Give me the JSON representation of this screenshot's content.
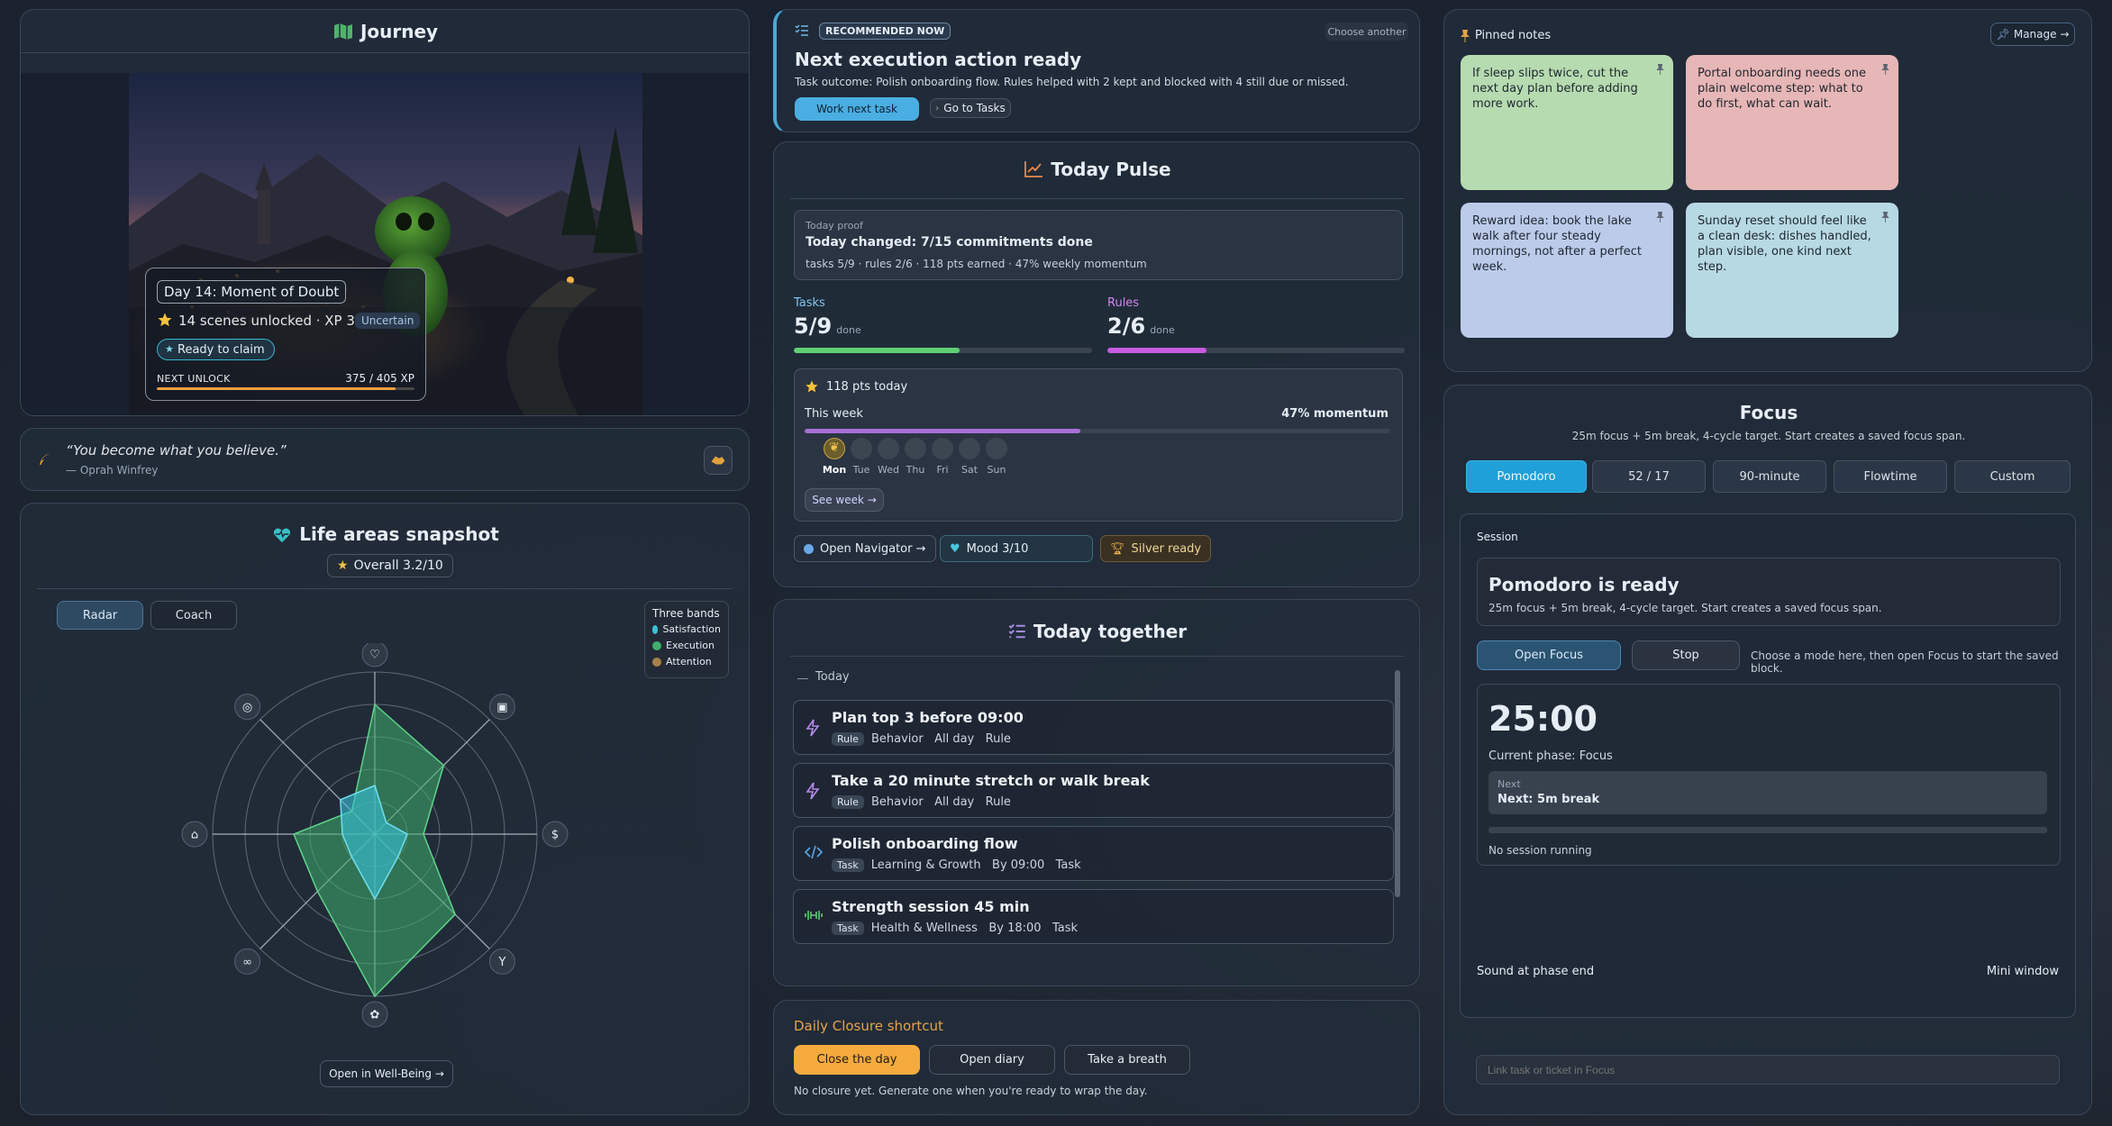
{
  "journey": {
    "title": "Journey",
    "day_title": "Day 14: Moment of Doubt",
    "scenes": "14 scenes unlocked · XP 375",
    "status_badge": "Uncertain",
    "claim_label": "Ready to claim",
    "next_unlock_label": "NEXT UNLOCK",
    "xp_progress": "375 / 405 XP",
    "xp_fraction": 0.926
  },
  "quote": {
    "text": "“You become what you believe.”",
    "author": "— Oprah Winfrey"
  },
  "life_areas": {
    "title": "Life areas snapshot",
    "overall": "Overall 3.2/10",
    "tabs": [
      "Radar",
      "Coach"
    ],
    "legend_title": "Three bands",
    "legend": [
      {
        "label": "Satisfaction",
        "color": "#39c2d7"
      },
      {
        "label": "Execution",
        "color": "#3fae6e"
      },
      {
        "label": "Attention",
        "color": "#a8824a"
      }
    ],
    "open_link": "Open in Well-Being →",
    "axis_icons": [
      "heart-icon",
      "briefcase-icon",
      "dollar-icon",
      "trophy-icon",
      "leaf-icon",
      "brain-icon",
      "home-icon",
      "compass-icon"
    ],
    "chart_data": {
      "type": "radar",
      "axes": 8,
      "series": [
        {
          "values": [
            8,
            6,
            3,
            7,
            10,
            5,
            5,
            2
          ]
        },
        {
          "values": [
            3,
            1,
            2,
            2,
            4,
            2,
            2,
            3
          ]
        }
      ],
      "rmax": 10,
      "rings": 5
    }
  },
  "recommended": {
    "badge": "RECOMMENDED NOW",
    "choose": "Choose another",
    "title": "Next execution action ready",
    "subtitle": "Task outcome: Polish onboarding flow. Rules helped with 2 kept and blocked with 4 still due or missed.",
    "primary": "Work next task",
    "secondary": "Go to Tasks"
  },
  "pulse": {
    "title": "Today Pulse",
    "proof_label": "Today proof",
    "proof_title": "Today changed: 7/15 commitments done",
    "proof_sub": "tasks 5/9 · rules 2/6 · 118 pts earned · 47% weekly momentum",
    "tasks_label": "Tasks",
    "tasks_value": "5/9",
    "tasks_done": "done",
    "tasks_fraction": 0.556,
    "rules_label": "Rules",
    "rules_value": "2/6",
    "rules_done": "done",
    "rules_fraction": 0.333,
    "pts": "118 pts today",
    "week_label": "This week",
    "momentum": "47% momentum",
    "momentum_fraction": 0.47,
    "days": [
      "Mon",
      "Tue",
      "Wed",
      "Thu",
      "Fri",
      "Sat",
      "Sun"
    ],
    "see_week": "See week →",
    "navigator": "Open Navigator →",
    "mood": "Mood 3/10",
    "silver": "Silver ready"
  },
  "together": {
    "title": "Today together",
    "section": "Today",
    "items": [
      {
        "title": "Plan top 3 before 09:00",
        "tag": "Rule",
        "meta": "Behavior   All day   Rule",
        "icon": "bolt-icon"
      },
      {
        "title": "Take a 20 minute stretch or walk break",
        "tag": "Rule",
        "meta": "Behavior   All day   Rule",
        "icon": "bolt-icon"
      },
      {
        "title": "Polish onboarding flow",
        "tag": "Task",
        "meta": "Learning & Growth   By 09:00   Task",
        "icon": "code-icon"
      },
      {
        "title": "Strength session 45 min",
        "tag": "Task",
        "meta": "Health & Wellness   By 18:00   Task",
        "icon": "dumbbell-icon"
      }
    ]
  },
  "closure": {
    "title": "Daily Closure shortcut",
    "close": "Close the day",
    "diary": "Open diary",
    "breath": "Take a breath",
    "note": "No closure yet. Generate one when you're ready to wrap the day."
  },
  "notes": {
    "title": "Pinned notes",
    "manage": "Manage →",
    "items": [
      {
        "text": "If sleep slips twice, cut the next day plan before adding more work.",
        "color": "#b6dbb0"
      },
      {
        "text": "Portal onboarding needs one plain welcome step: what to do first, what can wait.",
        "color": "#e7b6b6"
      },
      {
        "text": "Reward idea: book the lake walk after four steady mornings, not after a perfect week.",
        "color": "#bccbea"
      },
      {
        "text": "Sunday reset should feel like a clean desk: dishes handled, plan visible, one kind next step.",
        "color": "#b7d9e3"
      }
    ]
  },
  "focus": {
    "title": "Focus",
    "subtitle": "25m focus + 5m break, 4-cycle target. Start creates a saved focus span.",
    "modes": [
      "Pomodoro",
      "52 / 17",
      "90-minute",
      "Flowtime",
      "Custom"
    ],
    "session_label": "Session",
    "ready_title": "Pomodoro is ready",
    "ready_sub": "25m focus + 5m break, 4-cycle target. Start creates a saved focus span.",
    "open": "Open Focus",
    "stop": "Stop",
    "hint": "Choose a mode here, then open Focus to start the saved block.",
    "timer": "25:00",
    "phase": "Current phase: Focus",
    "next_label": "Next",
    "next_value": "Next: 5m break",
    "no_session": "No session running",
    "sound": "Sound at phase end",
    "mini": "Mini window",
    "link_placeholder": "Link task or ticket in Focus"
  }
}
